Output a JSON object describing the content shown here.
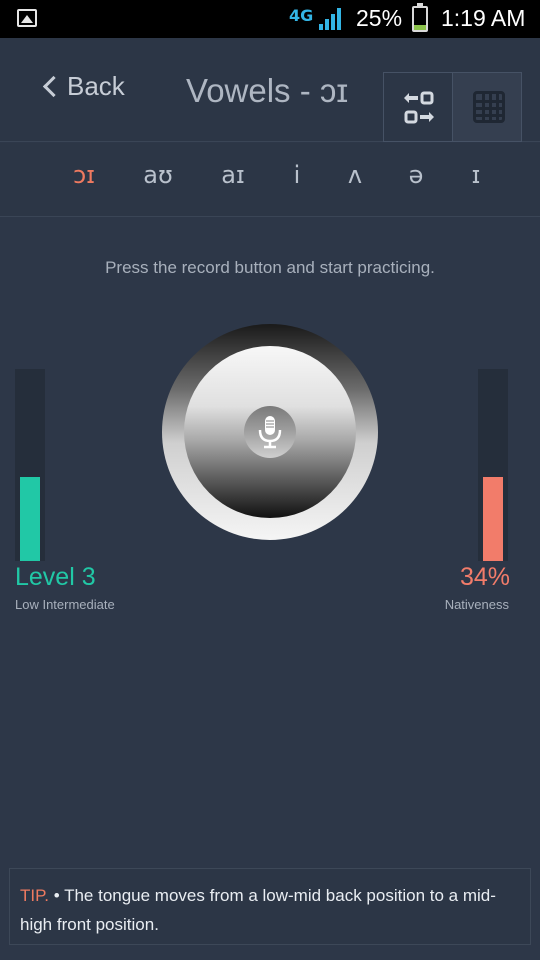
{
  "status_bar": {
    "network": "4G",
    "battery_percent": "25%",
    "time": "1:19 AM",
    "battery_level": 0.25,
    "icons": [
      "gallery-icon",
      "signal-icon",
      "battery-icon"
    ]
  },
  "header": {
    "back_label": "Back",
    "title": "Vowels - ɔɪ",
    "icons": [
      "compare-icon",
      "grid-icon"
    ]
  },
  "tabs": [
    {
      "label": "ɔɪ",
      "active": true
    },
    {
      "label": "aʊ",
      "active": false
    },
    {
      "label": "aɪ",
      "active": false
    },
    {
      "label": "i",
      "active": false
    },
    {
      "label": "ʌ",
      "active": false
    },
    {
      "label": "ə",
      "active": false
    },
    {
      "label": "ɪ",
      "active": false
    }
  ],
  "main": {
    "hint": "Press the record button and start practicing.",
    "level": {
      "value": "Level 3",
      "description": "Low Intermediate",
      "fill": 0.44
    },
    "nativeness": {
      "value": "34%",
      "description": "Nativeness",
      "fill": 0.44
    }
  },
  "tip": {
    "label": "TIP.",
    "text": " • The tongue moves from a low-mid back position to a mid-high front position."
  },
  "colors": {
    "accent_teal": "#21c8a6",
    "accent_coral": "#f27c6a",
    "active_tab": "#ef7a60",
    "background": "#2d3748"
  }
}
